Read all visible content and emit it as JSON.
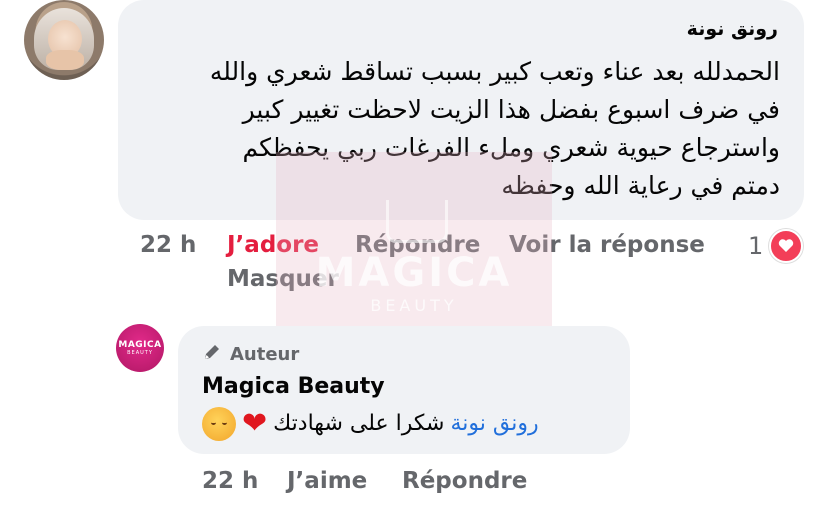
{
  "comment": {
    "author": "رونق نونة",
    "lines": [
      "الحمدلله بعد عناء وتعب كبير بسبب تساقط شعري  والله",
      "في ضرف اسبوع بفضل هذا الزيت لاحظت تغيير كبير",
      "واسترجاع حيوية  شعري وملء الفرغات  ربي يحفظكم",
      "دمتم في رعاية الله وحفظه"
    ],
    "time": "22 h",
    "reaction_label": "J’adore",
    "reply_label": "Répondre",
    "see_reply_label": "Voir la réponse",
    "hide_label": "Masquer",
    "reaction_count": "1",
    "reaction_icon": "heart-icon"
  },
  "reply": {
    "badge": "Auteur",
    "badge_icon": "pencil-icon",
    "author": "Magica Beauty",
    "mention": "رونق نونة",
    "text": "شكرا على شهادتك",
    "emojis": [
      "red-heart-emoji",
      "smiling-face-with-hearts-emoji"
    ],
    "time": "22 h",
    "like_label": "J’aime",
    "reply_label": "Répondre",
    "avatar_logo": "MAGICA",
    "avatar_logo_sub": "BEAUTY"
  },
  "watermark": {
    "title": "MAGICA",
    "subtitle": "BEAUTY"
  },
  "colors": {
    "bubble": "#f0f2f5",
    "secondary_text": "#65676b",
    "love_red": "#f33e58",
    "mention_blue": "#216fdb",
    "brand_pink": "#c91b76"
  }
}
